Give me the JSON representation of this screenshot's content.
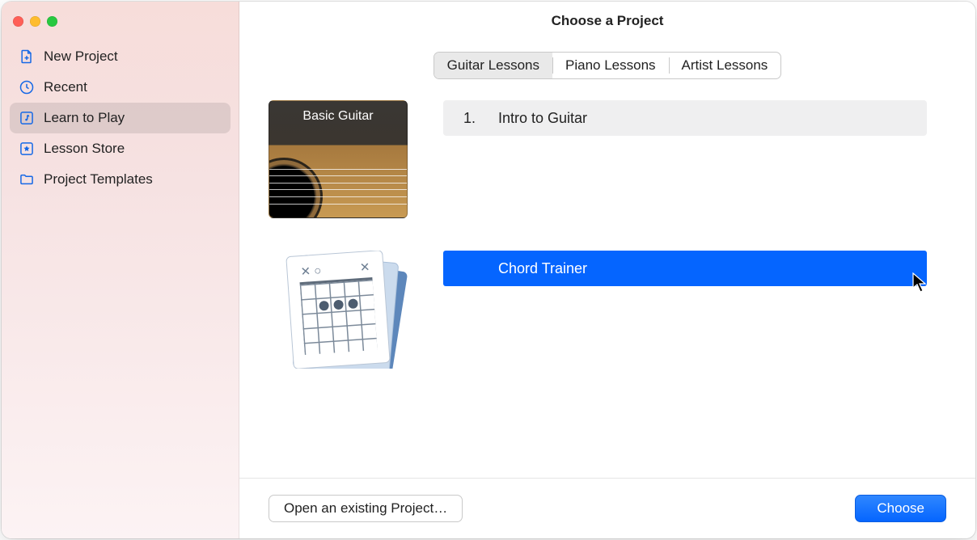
{
  "window": {
    "title": "Choose a Project"
  },
  "sidebar": {
    "items": [
      {
        "label": "New Project"
      },
      {
        "label": "Recent"
      },
      {
        "label": "Learn to Play"
      },
      {
        "label": "Lesson Store"
      },
      {
        "label": "Project Templates"
      }
    ]
  },
  "segments": {
    "items": [
      {
        "label": "Guitar Lessons"
      },
      {
        "label": "Piano Lessons"
      },
      {
        "label": "Artist Lessons"
      }
    ]
  },
  "lessons": {
    "basic_guitar_thumb": "Basic Guitar",
    "row1_num": "1.",
    "row1_title": "Intro to Guitar",
    "row2_title": "Chord Trainer"
  },
  "footer": {
    "open": "Open an existing Project…",
    "choose": "Choose"
  },
  "chord_card": {
    "left": "✕ ○",
    "right": "✕"
  }
}
